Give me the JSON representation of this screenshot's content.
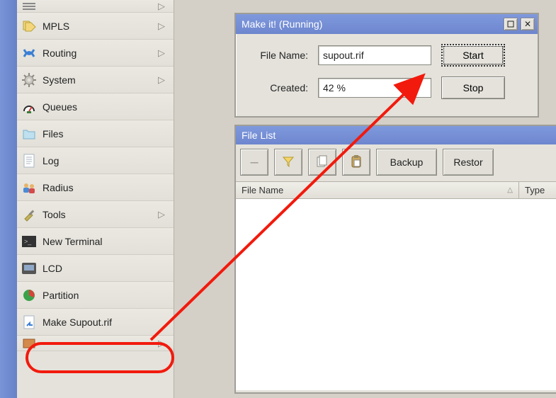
{
  "sidebar": {
    "items": [
      {
        "label": "",
        "has_sub": false,
        "icon": "bars"
      },
      {
        "label": "MPLS",
        "has_sub": true,
        "icon": "tags"
      },
      {
        "label": "Routing",
        "has_sub": true,
        "icon": "routing"
      },
      {
        "label": "System",
        "has_sub": true,
        "icon": "gear"
      },
      {
        "label": "Queues",
        "has_sub": false,
        "icon": "gauge"
      },
      {
        "label": "Files",
        "has_sub": false,
        "icon": "folder"
      },
      {
        "label": "Log",
        "has_sub": false,
        "icon": "log"
      },
      {
        "label": "Radius",
        "has_sub": false,
        "icon": "users"
      },
      {
        "label": "Tools",
        "has_sub": true,
        "icon": "tools"
      },
      {
        "label": "New Terminal",
        "has_sub": false,
        "icon": "terminal"
      },
      {
        "label": "LCD",
        "has_sub": false,
        "icon": "lcd"
      },
      {
        "label": "Partition",
        "has_sub": false,
        "icon": "pie"
      },
      {
        "label": "Make Supout.rif",
        "has_sub": false,
        "icon": "makefile"
      },
      {
        "label": "",
        "has_sub": true,
        "icon": "book"
      }
    ]
  },
  "makeit": {
    "title": "Make it! (Running)",
    "file_label": "File Name:",
    "file_value": "supout.rif",
    "created_label": "Created:",
    "created_value": "42 %",
    "start": "Start",
    "stop": "Stop"
  },
  "filelist": {
    "title": "File List",
    "btn_backup": "Backup",
    "btn_restore": "Restor",
    "col_name": "File Name",
    "col_type": "Type"
  },
  "icons": {
    "minus": "–",
    "funnel": "▼",
    "copy": "⧉",
    "paste": "📋",
    "close": "✕",
    "minimize": "▁",
    "sort": "△",
    "chev": "▷"
  }
}
